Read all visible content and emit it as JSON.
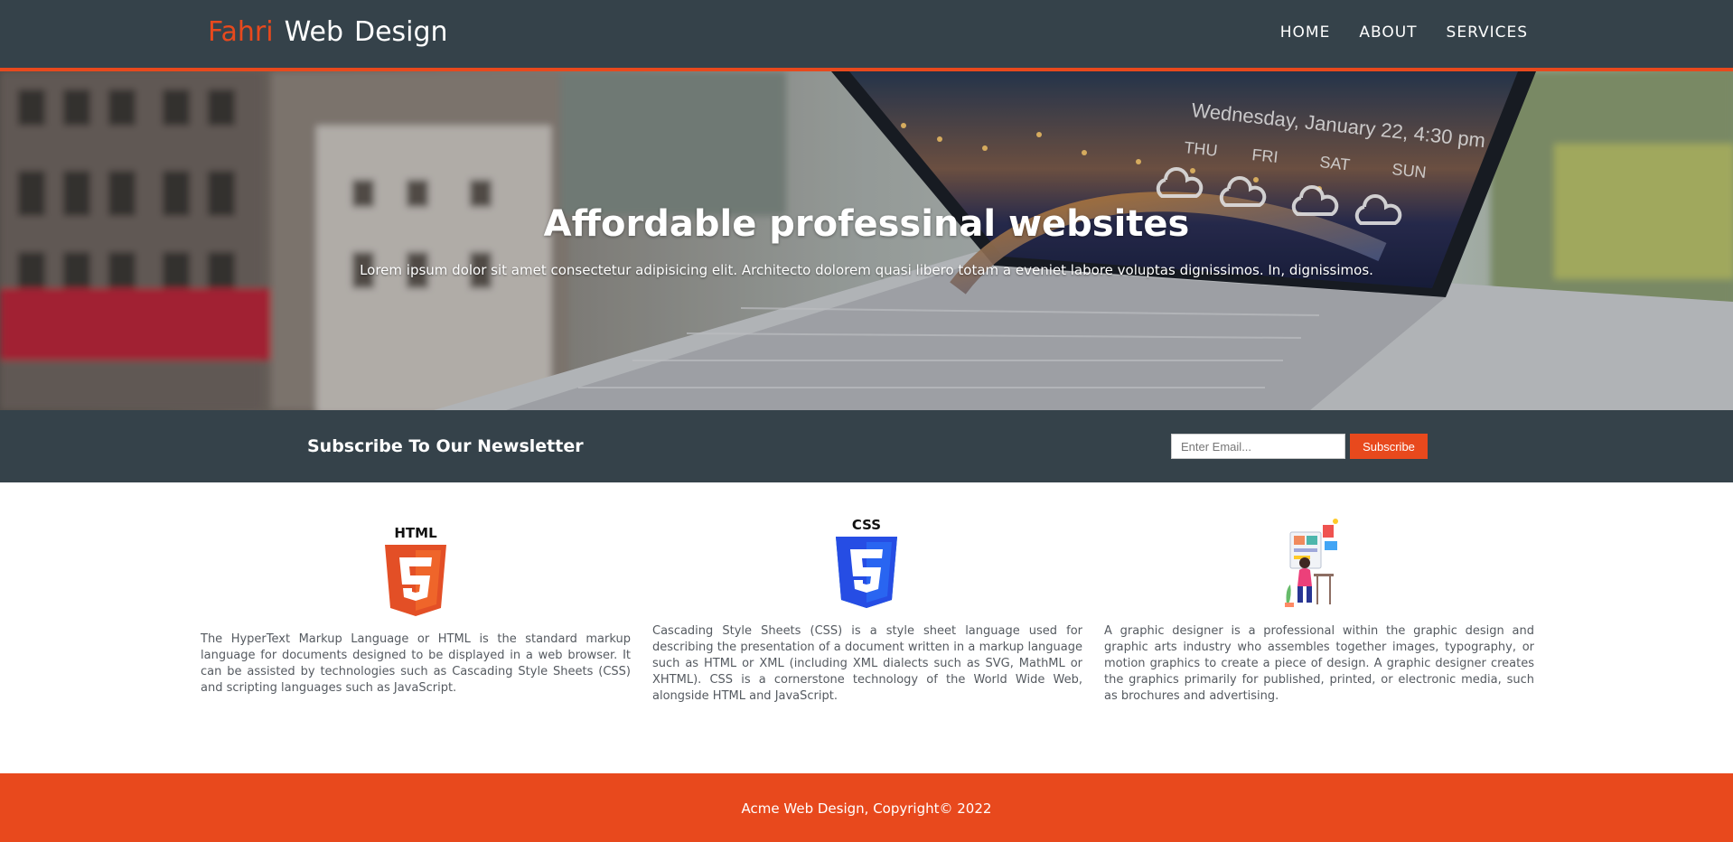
{
  "header": {
    "logo_highlight": "Fahri",
    "logo_rest_1": "Web",
    "logo_rest_2": "Design",
    "nav": [
      "HOME",
      "ABOUT",
      "SERVICES"
    ]
  },
  "hero": {
    "title": "Affordable professinal websites",
    "subtitle": "Lorem ipsum dolor sit amet consectetur adipisicing elit. Architecto dolorem quasi libero totam a eveniet labore voluptas dignissimos. In, dignissimos.",
    "screen_date": "Wednesday, January 22, 4:30 pm",
    "screen_days": [
      "THU",
      "FRI",
      "SAT",
      "SUN"
    ]
  },
  "newsletter": {
    "title": "Subscribe To Our Newsletter",
    "email_placeholder": "Enter Email...",
    "button_label": "Subscribe"
  },
  "boxes": [
    {
      "icon": "html5-icon",
      "icon_text": "HTML",
      "text": "The HyperText Markup Language or HTML is the standard markup language for documents designed to be displayed in a web browser. It can be assisted by technologies such as Cascading Style Sheets (CSS) and scripting languages such as JavaScript."
    },
    {
      "icon": "css3-icon",
      "icon_text": "CSS",
      "text": "Cascading Style Sheets (CSS) is a style sheet language used for describing the presentation of a document written in a markup language such as HTML or XML (including XML dialects such as SVG, MathML or XHTML). CSS is a cornerstone technology of the World Wide Web, alongside HTML and JavaScript."
    },
    {
      "icon": "graphic-designer-icon",
      "text": "A graphic designer is a professional within the graphic design and graphic arts industry who assembles together images, typography, or motion graphics to create a piece of design. A graphic designer creates the graphics primarily for published, printed, or electronic media, such as brochures and advertising."
    }
  ],
  "footer": {
    "text": "Acme Web Design, Copyright© 2022"
  },
  "colors": {
    "dark": "#35424a",
    "accent": "#e8491d"
  }
}
